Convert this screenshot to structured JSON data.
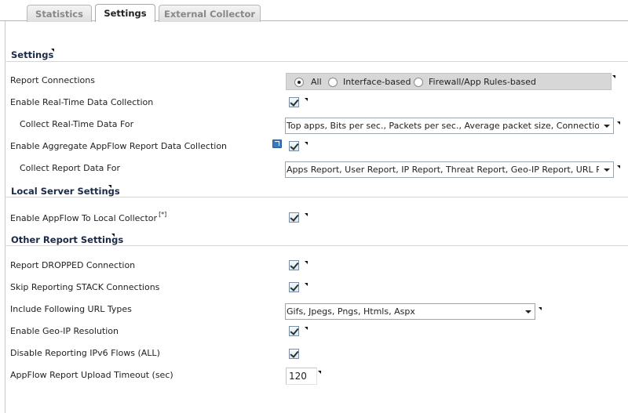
{
  "tabs": {
    "statistics": "Statistics",
    "settings": "Settings",
    "external_collector": "External Collector"
  },
  "sections": {
    "settings": "Settings",
    "local_server": "Local Server Settings",
    "other_report": "Other Report Settings"
  },
  "fields": {
    "report_connections": {
      "label": "Report Connections",
      "options": [
        "All",
        "Interface-based",
        "Firewall/App Rules-based"
      ],
      "selected": "All"
    },
    "enable_realtime": {
      "label": "Enable Real-Time Data Collection",
      "checked": true
    },
    "collect_realtime_for": {
      "label": "Collect Real-Time Data For",
      "value": "Top apps, Bits per sec., Packets per sec., Average packet size, Connections per"
    },
    "enable_aggregate": {
      "label": "Enable Aggregate AppFlow Report Data Collection",
      "checked": true
    },
    "collect_report_for": {
      "label": "Collect Report Data For",
      "value": "Apps Report, User Report, IP Report, Threat Report, Geo-IP Report, URL Report"
    },
    "enable_local_collector": {
      "label": "Enable AppFlow To Local Collector",
      "note": "[*]",
      "checked": true
    },
    "report_dropped": {
      "label": "Report DROPPED Connection",
      "checked": true
    },
    "skip_stack": {
      "label": "Skip Reporting STACK Connections",
      "checked": true
    },
    "url_types": {
      "label": "Include Following URL Types",
      "value": "Gifs, Jpegs, Pngs, Htmls, Aspx"
    },
    "geo_ip": {
      "label": "Enable Geo-IP Resolution",
      "checked": true
    },
    "disable_ipv6": {
      "label": "Disable Reporting IPv6 Flows (ALL)",
      "checked": true
    },
    "upload_timeout": {
      "label": "AppFlow Report Upload Timeout (sec)",
      "value": "120"
    }
  }
}
